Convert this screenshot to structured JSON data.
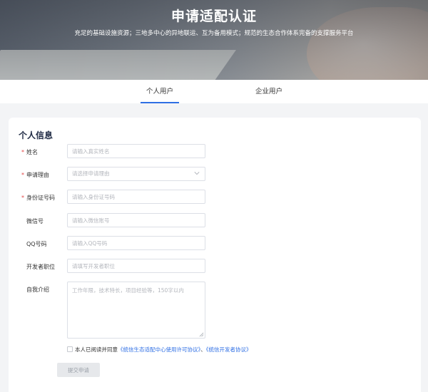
{
  "hero": {
    "title": "申请适配认证",
    "subtitle": "充足的基础设施资源；三地多中心的异地联运、互为备用模式；规范的生态合作体系完备的支撑服务平台"
  },
  "tabs": [
    {
      "label": "个人用户",
      "active": true
    },
    {
      "label": "企业用户",
      "active": false
    }
  ],
  "form": {
    "section_title": "个人信息",
    "fields": {
      "name": {
        "label": "姓名",
        "required": true,
        "placeholder": "请输入真实姓名"
      },
      "reason": {
        "label": "申请理由",
        "required": true,
        "placeholder": "请选择申请理由"
      },
      "id_number": {
        "label": "身份证号码",
        "required": true,
        "placeholder": "请输入身份证号码"
      },
      "wechat": {
        "label": "微信号",
        "required": false,
        "placeholder": "请输入微信账号"
      },
      "qq": {
        "label": "QQ号码",
        "required": false,
        "placeholder": "请输入QQ号码"
      },
      "position": {
        "label": "开发者职位",
        "required": false,
        "placeholder": "请填写开发者职位"
      },
      "intro": {
        "label": "自我介绍",
        "required": false,
        "placeholder": "工作年限，技术特长，项目经验等，150字以内"
      }
    },
    "required_mark": "*",
    "agreement": {
      "prefix": "本人已阅读并同意",
      "link1": "《统信生态适配中心使用许可协议》",
      "separator": "、",
      "link2": "《统信开发者协议》"
    },
    "submit_label": "提交申请"
  },
  "colors": {
    "accent": "#2f6fe4",
    "required": "#e34848"
  }
}
